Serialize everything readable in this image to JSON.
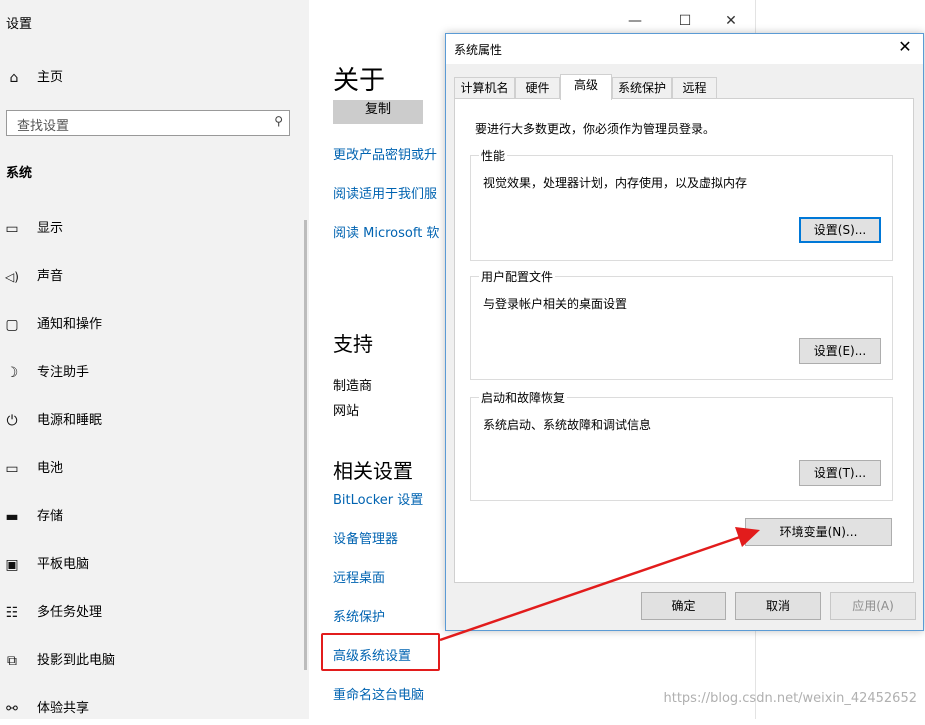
{
  "app": {
    "title": "设置"
  },
  "sidebar": {
    "home_label": "主页",
    "search_placeholder": "查找设置",
    "section_title": "系统",
    "items": [
      {
        "label": "显示",
        "icon": "monitor-icon"
      },
      {
        "label": "声音",
        "icon": "speaker-icon"
      },
      {
        "label": "通知和操作",
        "icon": "notification-icon"
      },
      {
        "label": "专注助手",
        "icon": "moon-icon"
      },
      {
        "label": "电源和睡眠",
        "icon": "power-icon"
      },
      {
        "label": "电池",
        "icon": "battery-icon"
      },
      {
        "label": "存储",
        "icon": "storage-icon"
      },
      {
        "label": "平板电脑",
        "icon": "tablet-icon"
      },
      {
        "label": "多任务处理",
        "icon": "multitask-icon"
      },
      {
        "label": "投影到此电脑",
        "icon": "project-icon"
      },
      {
        "label": "体验共享",
        "icon": "share-icon"
      }
    ]
  },
  "window_controls": {
    "minimize": "—",
    "maximize": "☐",
    "close": "✕"
  },
  "about": {
    "title": "关于",
    "copy_button": "复制",
    "links": [
      "更改产品密钥或升",
      "阅读适用于我们服",
      "阅读 Microsoft 软"
    ],
    "support_title": "支持",
    "support_rows": [
      {
        "label": "制造商"
      },
      {
        "label": "网站"
      }
    ],
    "related_title": "相关设置",
    "related_links": [
      "BitLocker 设置",
      "设备管理器",
      "远程桌面",
      "系统保护",
      "高级系统设置",
      "重命名这台电脑"
    ]
  },
  "dialog": {
    "title": "系统属性",
    "close": "✕",
    "tabs": [
      "计算机名",
      "硬件",
      "高级",
      "系统保护",
      "远程"
    ],
    "active_tab": "高级",
    "admin_note": "要进行大多数更改，你必须作为管理员登录。",
    "groups": [
      {
        "title": "性能",
        "desc": "视觉效果，处理器计划，内存使用，以及虚拟内存",
        "button": "设置(S)..."
      },
      {
        "title": "用户配置文件",
        "desc": "与登录帐户相关的桌面设置",
        "button": "设置(E)..."
      },
      {
        "title": "启动和故障恢复",
        "desc": "系统启动、系统故障和调试信息",
        "button": "设置(T)..."
      }
    ],
    "env_button": "环境变量(N)...",
    "ok": "确定",
    "cancel": "取消",
    "apply": "应用(A)"
  },
  "watermark": "https://blog.csdn.net/weixin_42452652",
  "colors": {
    "link": "#0063b1",
    "highlight": "#e21c1c",
    "focus": "#0078d7"
  }
}
